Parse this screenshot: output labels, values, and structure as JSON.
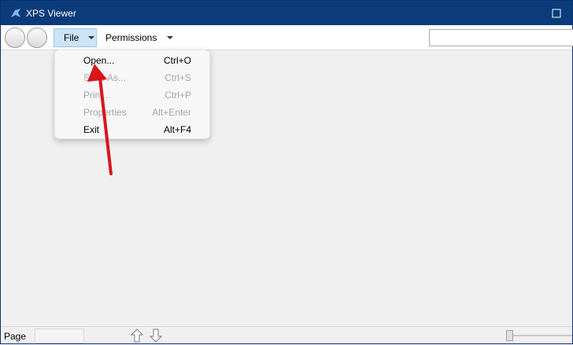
{
  "window": {
    "title": "XPS Viewer"
  },
  "toolbar": {
    "file_label": "File",
    "permissions_label": "Permissions",
    "search_value": ""
  },
  "file_menu": {
    "items": [
      {
        "label": "Open...",
        "shortcut": "Ctrl+O",
        "enabled": true
      },
      {
        "label": "Save As...",
        "shortcut": "Ctrl+S",
        "enabled": false
      },
      {
        "label": "Print...",
        "shortcut": "Ctrl+P",
        "enabled": false
      },
      {
        "label": "Properties",
        "shortcut": "Alt+Enter",
        "enabled": false
      },
      {
        "label": "Exit",
        "shortcut": "Alt+F4",
        "enabled": true
      }
    ]
  },
  "statusbar": {
    "page_label": "Page",
    "page_value": ""
  },
  "icons": {
    "app": "xps-viewer-icon",
    "back": "back-icon",
    "forward": "forward-icon",
    "page_up": "arrow-up-icon",
    "page_down": "arrow-down-icon"
  },
  "colors": {
    "titlebar": "#0b3b7a",
    "menu_highlight": "#cce4f7",
    "annotation": "#d9151b"
  }
}
